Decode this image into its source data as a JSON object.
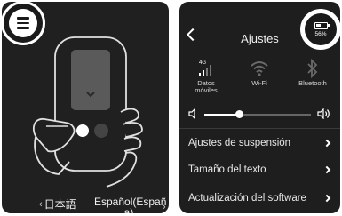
{
  "left_screen": {
    "language_prev": "日本語",
    "language_current_line1": "Español(Españ",
    "language_current_line2": "a)"
  },
  "right_screen": {
    "title": "Ajustes",
    "battery_percent": "56%",
    "quick_toggles": [
      {
        "icon": "mobile-data-4g-icon",
        "label_line1": "Datos",
        "label_line2": "móviles",
        "badge": "4G"
      },
      {
        "icon": "wifi-icon",
        "label_line1": "Wi-Fi",
        "label_line2": ""
      },
      {
        "icon": "bluetooth-icon",
        "label_line1": "Bluetooth",
        "label_line2": ""
      }
    ],
    "volume_level": 0.33,
    "menu_items": [
      {
        "label": "Ajustes de suspensión"
      },
      {
        "label": "Tamaño del texto"
      },
      {
        "label": "Actualización del software"
      }
    ]
  },
  "colors": {
    "screen_bg": "#1e1e1e",
    "text": "#e8e8e8",
    "highlight_ring": "#ffffff"
  }
}
